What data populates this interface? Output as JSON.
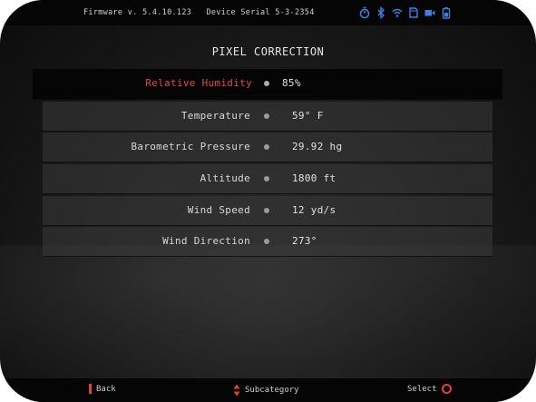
{
  "topbar": {
    "firmware": "Firmware v. 5.4.10.123",
    "serial": "Device Serial 5-3-2354",
    "icons": [
      "timer-icon",
      "bluetooth-icon",
      "wifi-icon",
      "sd-card-icon",
      "video-camera-icon",
      "battery-icon"
    ]
  },
  "page": {
    "title": "PIXEL CORRECTION"
  },
  "settings": [
    {
      "label": "Relative Humidity",
      "value": "85%"
    },
    {
      "label": "Temperature",
      "value": "59° F"
    },
    {
      "label": "Barometric Pressure",
      "value": "29.92 hg"
    },
    {
      "label": "Altitude",
      "value": "1800 ft"
    },
    {
      "label": "Wind Speed",
      "value": "12 yd/s"
    },
    {
      "label": "Wind Direction",
      "value": "273°"
    }
  ],
  "bottombar": {
    "back_label": "Back",
    "subcategory_label": "Subcategory",
    "select_label": "Select"
  },
  "colors": {
    "accent_red": "#e0484a",
    "background": "#1c1c1c",
    "bar": "#050505"
  }
}
